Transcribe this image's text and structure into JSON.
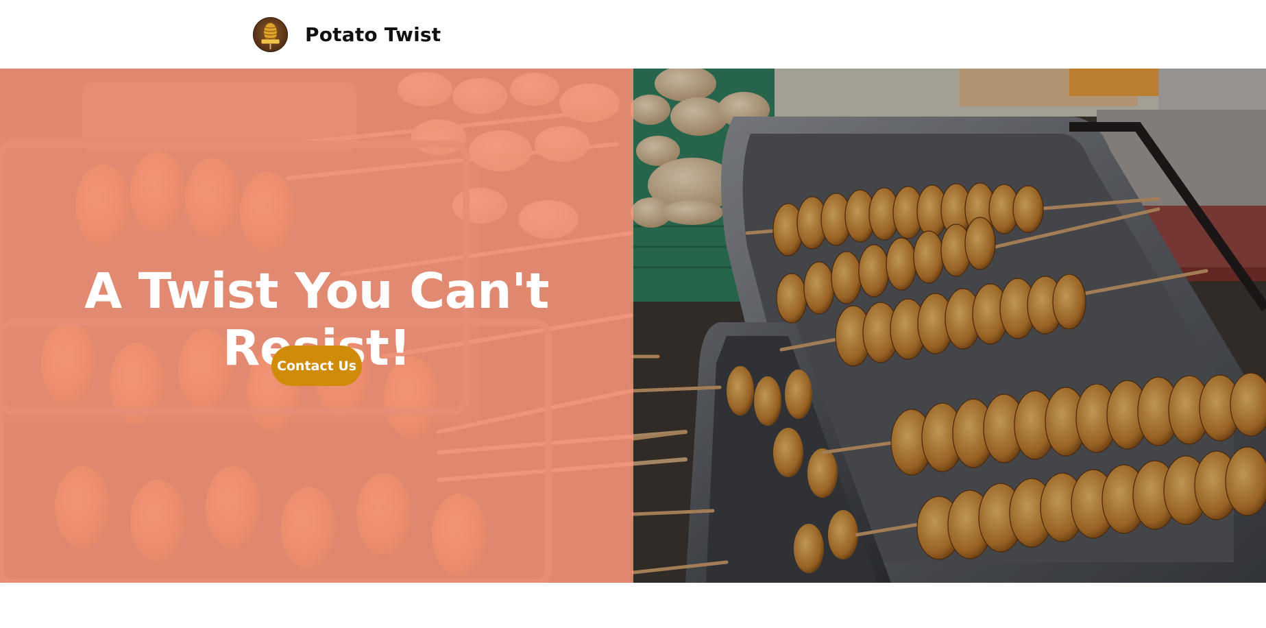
{
  "nav": {
    "brand_name": "Potato Twist",
    "logo_icon": "potato-twist-logo-icon"
  },
  "hero": {
    "headline": "A Twist You Can't Resist!",
    "cta_label": "Contact Us",
    "image": "spiral potato skewers on metal trays",
    "overlay_color": "#F49178",
    "cta_color": "#D08C08"
  }
}
